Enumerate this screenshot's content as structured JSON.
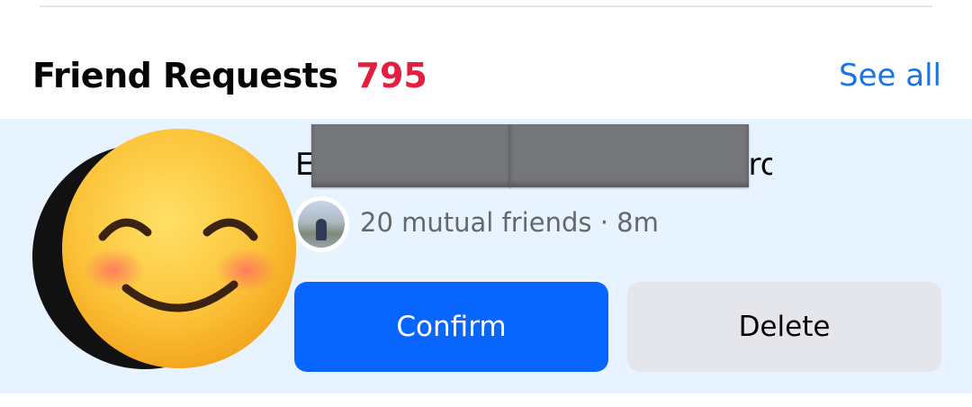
{
  "section": {
    "title": "Friend Requests",
    "count": "795",
    "see_all_label": "See all"
  },
  "request": {
    "name_visible_start": "E",
    "name_visible_end": "ro",
    "mutual_text": "20 mutual friends · 8m",
    "confirm_label": "Confirm",
    "delete_label": "Delete"
  },
  "colors": {
    "accent": "#1b74e4",
    "count_red": "#e41e3f",
    "confirm_blue": "#0866ff",
    "card_bg": "#e7f3ff",
    "delete_gray": "#e4e6eb",
    "redaction_gray": "#75767a"
  },
  "icons": {
    "avatar_overlay": "smiling-face-emoji-icon"
  }
}
